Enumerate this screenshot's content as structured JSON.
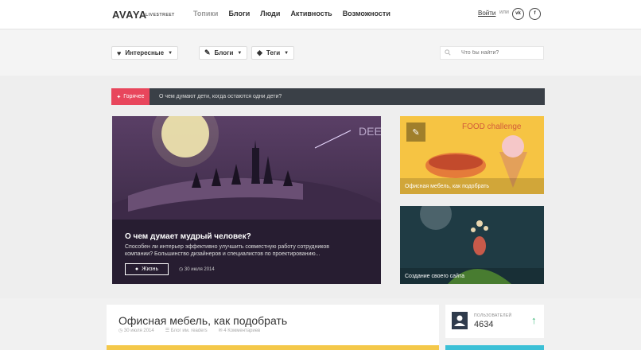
{
  "header": {
    "logo": "AVAYA",
    "logo_sub": "LIVESTREET",
    "nav": [
      "Топики",
      "Блоги",
      "Люди",
      "Активность",
      "Возможности"
    ],
    "login": "Войти",
    "or": "или",
    "social": [
      "vk",
      "f"
    ]
  },
  "filters": {
    "interesting": "Интересные",
    "blogs": "Блоги",
    "tags": "Теги",
    "search_placeholder": "Что бы найти?"
  },
  "hot": {
    "badge": "Горячее",
    "text": "О чем думают дети, когда остаются одни дети?"
  },
  "featured": {
    "title": "О чем думает мудрый человек?",
    "desc": "Способен ли интерьер эффективно улучшить совместную работу сотрудников компании? Большинство дизайнеров и специалистов по проектированию...",
    "tag": "Жизнь",
    "date": "30 июля 2014",
    "art_text": "DEEP DREAM"
  },
  "side": [
    {
      "title": "Офисная мебель, как подобрать",
      "art_text": "FOOD challenge"
    },
    {
      "title": "Создание своего сайта"
    }
  ],
  "post": {
    "title": "Офисная мебель, как подобрать",
    "date": "30 июля 2014",
    "blog": "Блог им. readers",
    "comments": "4 Комментариев"
  },
  "stat": {
    "label": "ПОЛЬЗОВАТЕЛЕЙ",
    "value": "4634"
  },
  "colors": {
    "hot": "#e8465c",
    "dark": "#3a4047",
    "green": "#3cb878",
    "cyan": "#3cc0d6",
    "yellow": "#f4c84a"
  }
}
